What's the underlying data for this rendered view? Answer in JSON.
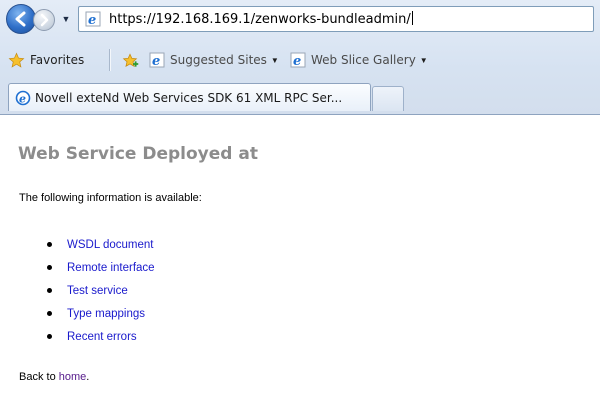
{
  "browser": {
    "url": "https://192.168.169.1/zenworks-bundleadmin/",
    "favorites_label": "Favorites",
    "suggested_sites_label": "Suggested Sites",
    "web_slice_gallery_label": "Web Slice Gallery",
    "tab_title": "Novell exteNd Web Services SDK 61 XML RPC Ser..."
  },
  "page": {
    "heading": "Web Service Deployed at",
    "intro": "The following information is available:",
    "links": [
      {
        "label": "WSDL document"
      },
      {
        "label": "Remote interface"
      },
      {
        "label": "Test service"
      },
      {
        "label": "Type mappings"
      },
      {
        "label": "Recent errors"
      }
    ],
    "back_prefix": "Back to ",
    "back_link": "home",
    "back_suffix": "."
  },
  "colors": {
    "heading": "#8c8c8c",
    "link": "#1a1acc",
    "visited_link": "#551a8b"
  },
  "icons": [
    "back-arrow-icon",
    "forward-arrow-icon",
    "ie-page-icon",
    "favorites-star-icon",
    "add-favorite-icon"
  ]
}
